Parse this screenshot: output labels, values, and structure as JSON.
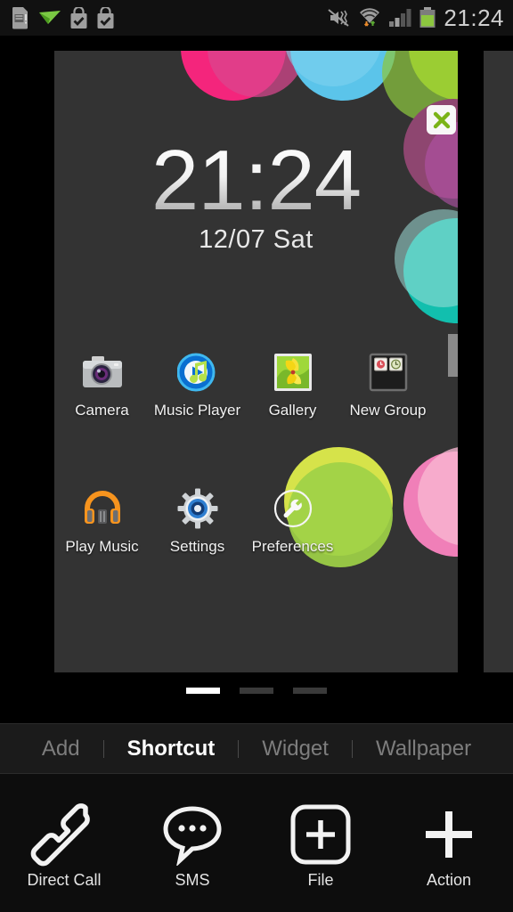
{
  "statusbar": {
    "time": "21:24",
    "left_icons": [
      "sd-card-icon",
      "send-mail-icon",
      "play-store-download-icon",
      "play-store-download-icon"
    ],
    "right_icons": [
      "vibrate-mute-icon",
      "wifi-transfer-icon",
      "cellular-signal-icon",
      "battery-icon"
    ]
  },
  "preview": {
    "clock": {
      "time": "21:24",
      "date": "12/07 Sat"
    },
    "close_button": {
      "label": "x",
      "icon": "close-icon"
    },
    "app_rows": [
      [
        {
          "label": "Camera",
          "icon": "camera-icon"
        },
        {
          "label": "Music Player",
          "icon": "music-player-icon"
        },
        {
          "label": "Gallery",
          "icon": "gallery-icon"
        },
        {
          "label": "New Group",
          "icon": "folder-group-icon"
        }
      ],
      [
        {
          "label": "Play Music",
          "icon": "play-music-icon"
        },
        {
          "label": "Settings",
          "icon": "settings-gear-icon"
        },
        {
          "label": "Preferences",
          "icon": "wrench-icon"
        }
      ]
    ],
    "wallpaper_circles": [
      {
        "name": "pink-circle",
        "color": "#f4257c",
        "overlay": "#d9468f"
      },
      {
        "name": "blue-circle",
        "color": "#5bc4ea",
        "overlay": "#7fd2ef"
      },
      {
        "name": "lime-circle",
        "color": "#c3dd16",
        "overlay": "#8cc63f"
      },
      {
        "name": "purple-circle",
        "color": "#8e4670",
        "overlay": "#b152a8"
      },
      {
        "name": "teal-circle",
        "color": "#12bfae",
        "overlay": "#9fdfd8"
      },
      {
        "name": "green-circle",
        "color": "#d6e34a",
        "overlay": "#9ed147"
      },
      {
        "name": "rose-circle",
        "color": "#f07fb8",
        "overlay": "#f9b7d2"
      }
    ]
  },
  "page_indicator": {
    "count": 3,
    "active": 1
  },
  "tabs": [
    {
      "label": "Add",
      "active": false
    },
    {
      "label": "Shortcut",
      "active": true
    },
    {
      "label": "Widget",
      "active": false
    },
    {
      "label": "Wallpaper",
      "active": false
    }
  ],
  "actions": [
    {
      "label": "Direct Call",
      "icon": "phone-handset-icon"
    },
    {
      "label": "SMS",
      "icon": "speech-bubble-icon"
    },
    {
      "label": "File",
      "icon": "plus-square-icon"
    },
    {
      "label": "Action",
      "icon": "plus-icon"
    }
  ],
  "ghost_dock": [
    {
      "icon": "contacts-icon"
    },
    {
      "icon": "app-drawer-icon"
    },
    {
      "icon": "browser-globe-icon"
    }
  ],
  "colors": {
    "panel_bg": "#333333",
    "screen_bg": "#000000",
    "tabbar_bg": "#1b1b1b",
    "actionbar_bg": "#0d0d0d",
    "active_tab": "#ffffff",
    "inactive_tab": "#7d7d7d"
  }
}
